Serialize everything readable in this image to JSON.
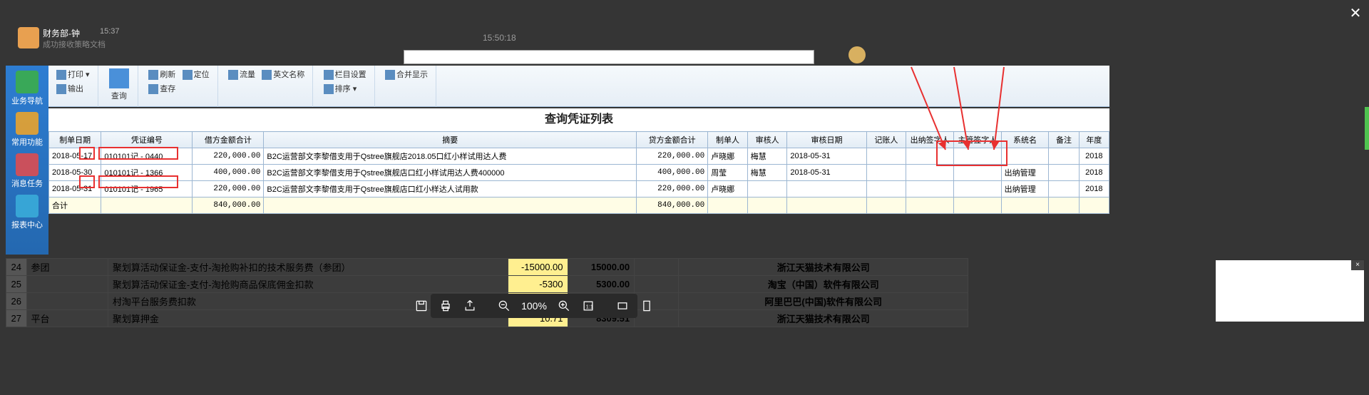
{
  "chat": {
    "name": "财务部-钟",
    "time": "15:37",
    "sub": "成功接收策略文档",
    "center_time": "15:50:18"
  },
  "close_label": "✕",
  "sidebar": {
    "items": [
      {
        "label": "业务导航"
      },
      {
        "label": "常用功能"
      },
      {
        "label": "消息任务"
      },
      {
        "label": "报表中心"
      }
    ]
  },
  "ribbon": {
    "print": "打印",
    "export": "输出",
    "query": "查询",
    "refresh": "刷新",
    "locate": "定位",
    "savequery": "查存",
    "flow": "流量",
    "en_name": "英文名称",
    "col_set": "栏目设置",
    "sort": "排序",
    "merge_show": "合并显示"
  },
  "table": {
    "title": "查询凭证列表",
    "headers": {
      "date": "制单日期",
      "voucher_no": "凭证编号",
      "debit": "借方金额合计",
      "summary": "摘要",
      "credit": "贷方金额合计",
      "maker": "制单人",
      "auditor": "审核人",
      "audit_date": "审核日期",
      "bookkeeper": "记账人",
      "cashier_sign": "出纳签字人",
      "supervisor": "主管签字人",
      "sys_name": "系统名",
      "remark": "备注",
      "year": "年度"
    },
    "rows": [
      {
        "date": "2018-05-17",
        "voucher_no": "010101记 - 0440",
        "debit": "220,000.00",
        "summary": "B2C运营部文李黎借支用于Qstree旗舰店2018.05口红小样试用达人费",
        "credit": "220,000.00",
        "maker": "卢晓娜",
        "auditor": "梅慧",
        "audit_date": "2018-05-31",
        "bookkeeper": "",
        "cashier_sign": "",
        "supervisor": "",
        "sys_name": "",
        "remark": "",
        "year": "2018"
      },
      {
        "date": "2018-05-30",
        "voucher_no": "010101记 - 1366",
        "debit": "400,000.00",
        "summary": "B2C运营部文李黎借支用于Qstree旗舰店口红小样试用达人费400000",
        "credit": "400,000.00",
        "maker": "周莹",
        "auditor": "梅慧",
        "audit_date": "2018-05-31",
        "bookkeeper": "",
        "cashier_sign": "",
        "supervisor": "",
        "sys_name": "出纳管理",
        "remark": "",
        "year": "2018"
      },
      {
        "date": "2018-05-31",
        "voucher_no": "010101记 - 1965",
        "debit": "220,000.00",
        "summary": "B2C运营部文李黎借支用于Qstree旗舰店口红小样达人试用款",
        "credit": "220,000.00",
        "maker": "卢晓娜",
        "auditor": "",
        "audit_date": "",
        "bookkeeper": "",
        "cashier_sign": "",
        "supervisor": "",
        "sys_name": "出纳管理",
        "remark": "",
        "year": "2018"
      }
    ],
    "total": {
      "label": "合计",
      "debit": "840,000.00",
      "credit": "840,000.00"
    }
  },
  "bg_rows": [
    {
      "n": "24",
      "type": "参团",
      "desc": "聚划算活动保证金-支付-淘抢购补扣的技术服务费（参团）",
      "neg": "-15000.00",
      "amt": "15000.00",
      "company": "浙江天猫技术有限公司"
    },
    {
      "n": "25",
      "type": "",
      "desc": "聚划算活动保证金-支付-淘抢购商品保底佣金扣款",
      "neg": "-5300",
      "amt": "5300.00",
      "company": "淘宝（中国）软件有限公司"
    },
    {
      "n": "26",
      "type": "",
      "desc": "村淘平台服务费扣款",
      "neg": "",
      "amt": "",
      "company": "阿里巴巴(中国)软件有限公司"
    },
    {
      "n": "27",
      "type": "平台",
      "desc": "聚划算押金",
      "neg": "10.71",
      "amt": "8309.51",
      "company": "浙江天猫技术有限公司"
    }
  ],
  "pdf": {
    "zoom": "100%"
  }
}
